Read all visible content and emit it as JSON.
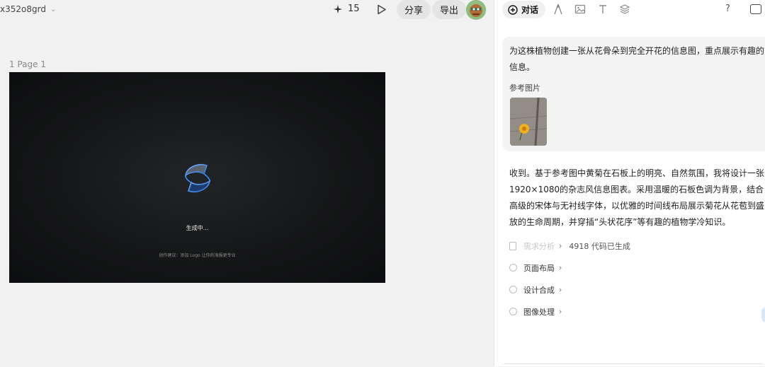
{
  "header": {
    "project_name": "x352o8grd",
    "credits": "15",
    "share_label": "分享",
    "export_label": "导出"
  },
  "canvas": {
    "page_label": "1 Page 1",
    "generating_text": "生成中...",
    "tip_text": "创作建议：添加 Logo 让你的海报更专业",
    "background_color": "#141516",
    "logo_color": "#2f8fff"
  },
  "panel": {
    "chat_tab_label": "对话",
    "help_label": "?",
    "user_message": "为这株植物创建一张从花骨朵到完全开花的信息图，重点展示有趣的信息。",
    "reference_label": "参考图片",
    "assistant_reply": "收到。基于参考图中黄菊在石板上的明亮、自然氛围，我将设计一张1920×1080的杂志风信息图表。采用温暖的石板色调为背景，结合高级的宋体与无衬线字体，以优雅的时间线布局展示菊花从花苞到盛放的生命周期，并穿插“头状花序”等有趣的植物学冷知识。",
    "steps": [
      {
        "label": "需求分析",
        "status": "4918 代码已生成",
        "icon": "doc-icon",
        "done": true
      },
      {
        "label": "页面布局",
        "icon": "circle-icon",
        "done": false
      },
      {
        "label": "设计合成",
        "icon": "circle-icon",
        "done": false
      },
      {
        "label": "图像处理",
        "icon": "circle-icon",
        "done": false
      }
    ]
  }
}
